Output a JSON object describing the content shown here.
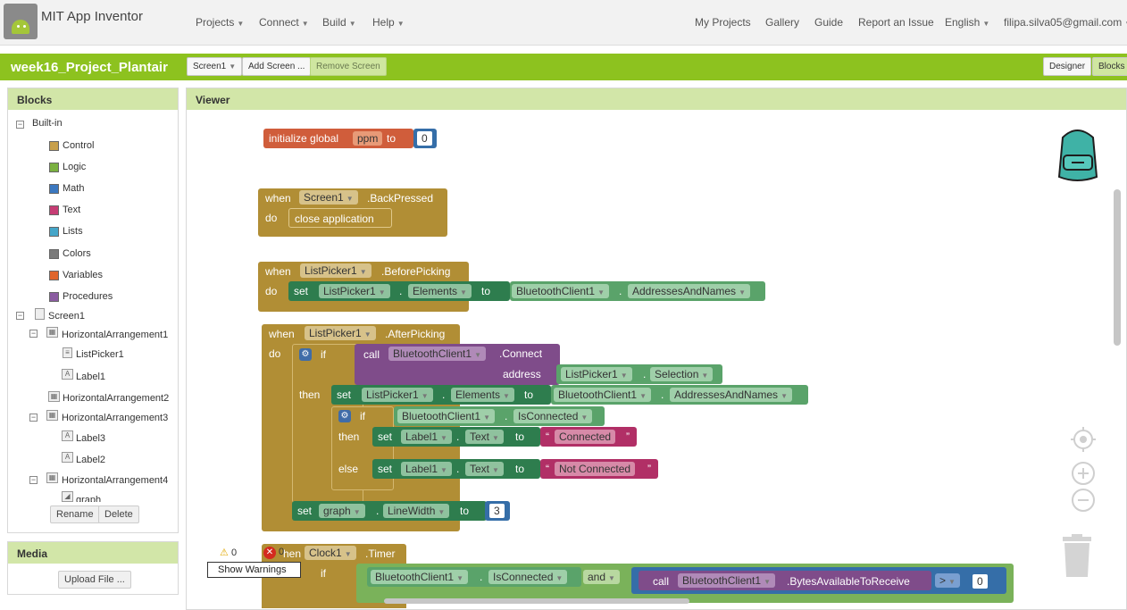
{
  "app": {
    "title": "MIT App Inventor"
  },
  "menu": {
    "left": [
      "Projects",
      "Connect",
      "Build",
      "Help"
    ],
    "right": [
      "My Projects",
      "Gallery",
      "Guide",
      "Report an Issue"
    ],
    "language": "English",
    "user": "filipa.silva05@gmail.com"
  },
  "project": {
    "name": "week16_Project_Plantair",
    "screen": "Screen1",
    "add_screen": "Add Screen ...",
    "remove_screen": "Remove Screen",
    "designer": "Designer",
    "blocks": "Blocks"
  },
  "blocks_panel": {
    "title": "Blocks",
    "builtin": "Built-in",
    "items": [
      "Control",
      "Logic",
      "Math",
      "Text",
      "Lists",
      "Colors",
      "Variables",
      "Procedures"
    ],
    "colors": [
      "#c8a04b",
      "#7ab040",
      "#3b78c0",
      "#c63d74",
      "#45a6c9",
      "#7a7a7a",
      "#e0652c",
      "#8b5ca1"
    ],
    "components": [
      "Screen1",
      "HorizontalArrangement1",
      "ListPicker1",
      "Label1",
      "HorizontalArrangement2",
      "HorizontalArrangement3",
      "Label3",
      "Label2",
      "HorizontalArrangement4",
      "graph"
    ],
    "rename": "Rename",
    "delete": "Delete"
  },
  "media": {
    "title": "Media",
    "upload": "Upload File ..."
  },
  "viewer": {
    "title": "Viewer"
  },
  "warnings": {
    "warn_count": "0",
    "err_count": "0",
    "show": "Show Warnings"
  },
  "code": {
    "init": "initialize global",
    "ppm": "ppm",
    "to": "to",
    "zero": "0",
    "when": "when",
    "do": "do",
    "screen1": "Screen1",
    "backpressed": ".BackPressed",
    "close": "close application",
    "listpicker1": "ListPicker1",
    "beforepicking": ".BeforePicking",
    "set": "set",
    "elements": "Elements",
    "bt": "BluetoothClient1",
    "addrnames": "AddressesAndNames",
    "afterpicking": ".AfterPicking",
    "if": "if",
    "call": "call",
    "connect": ".Connect",
    "address": "address",
    "selection": "Selection",
    "then": "then",
    "isconnected": "IsConnected",
    "label1": "Label1",
    "text": "Text",
    "connected": "Connected",
    "notconnected": "Not Connected",
    "else": "else",
    "graph": "graph",
    "linewidth": "LineWidth",
    "three": "3",
    "dot": ".",
    "quote_open": "“",
    "quote_close": "”",
    "clock1": "Clock1",
    "timer": ".Timer",
    "and": "and",
    "bytes": ".BytesAvailableToReceive",
    "gt": ">",
    "zero2": "0",
    "when_partial": "hen"
  }
}
